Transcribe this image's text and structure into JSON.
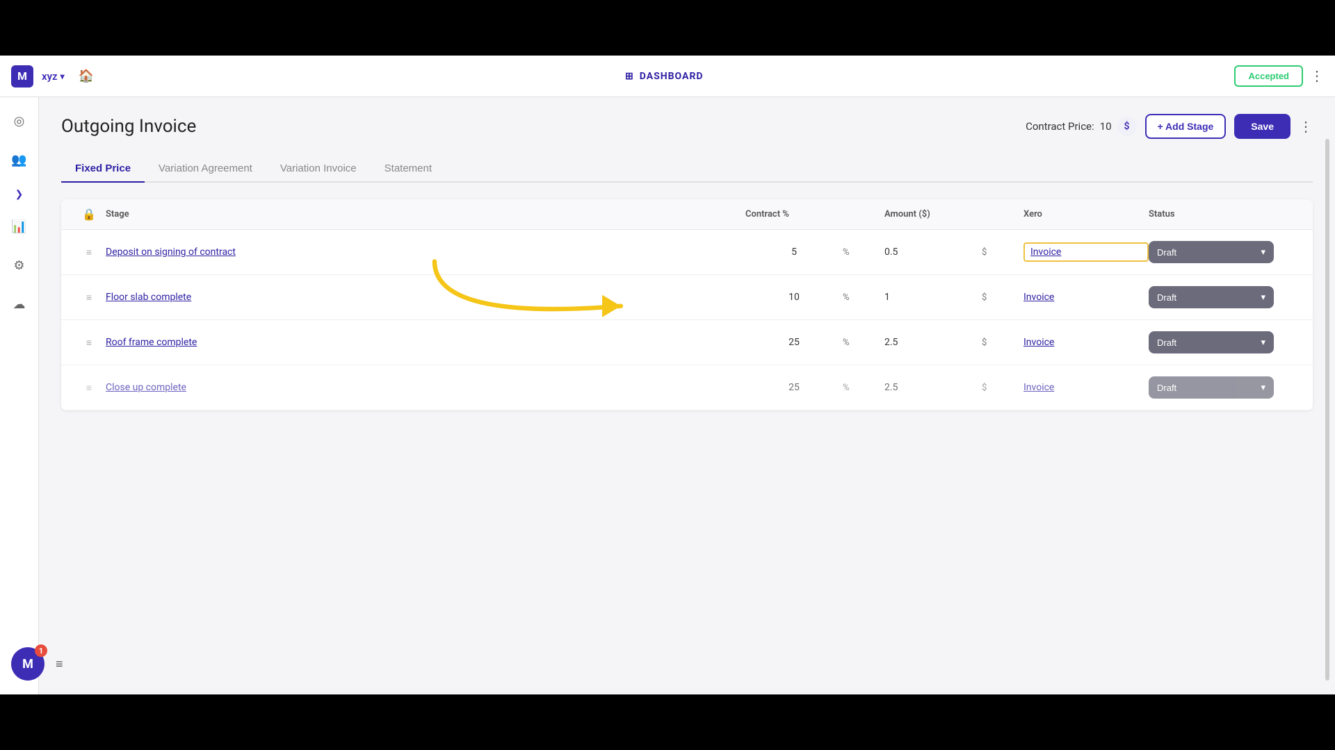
{
  "navbar": {
    "logo_letter": "M",
    "company": "xyz",
    "chevron": "▾",
    "home_icon": "🏠",
    "dashboard_label": "DASHBOARD",
    "dashboard_icon": "⊞",
    "accepted_label": "Accepted",
    "dots_label": "⋮"
  },
  "sidebar": {
    "expand_icon": "❯",
    "icons": [
      {
        "name": "chart-icon",
        "symbol": "◎"
      },
      {
        "name": "people-icon",
        "symbol": "👥"
      },
      {
        "name": "graph-icon",
        "symbol": "📊"
      },
      {
        "name": "settings-icon",
        "symbol": "⚙"
      },
      {
        "name": "cloud-icon",
        "symbol": "☁"
      }
    ]
  },
  "page": {
    "title": "Outgoing Invoice",
    "contract_price_label": "Contract Price:",
    "contract_price_value": "10",
    "currency_symbol": "$",
    "add_stage_label": "+ Add Stage",
    "save_label": "Save",
    "more_dots": "⋮"
  },
  "tabs": [
    {
      "id": "fixed-price",
      "label": "Fixed Price",
      "active": true
    },
    {
      "id": "variation-agreement",
      "label": "Variation Agreement",
      "active": false
    },
    {
      "id": "variation-invoice",
      "label": "Variation Invoice",
      "active": false
    },
    {
      "id": "statement",
      "label": "Statement",
      "active": false
    }
  ],
  "table": {
    "headers": {
      "lock": "🔒",
      "stage": "Stage",
      "contract_pct": "Contract %",
      "amount": "Amount ($)",
      "xero": "Xero",
      "status": "Status"
    },
    "rows": [
      {
        "drag": "≡",
        "stage_link": "Deposit on signing of contract",
        "contract_pct": "5",
        "pct_symbol": "%",
        "amount": "0.5",
        "dollar": "$",
        "xero_label": "Invoice",
        "xero_highlighted": true,
        "status": "Draft",
        "status_chevron": "▾"
      },
      {
        "drag": "≡",
        "stage_link": "Floor slab complete",
        "contract_pct": "10",
        "pct_symbol": "%",
        "amount": "1",
        "dollar": "$",
        "xero_label": "Invoice",
        "xero_highlighted": false,
        "status": "Draft",
        "status_chevron": "▾"
      },
      {
        "drag": "≡",
        "stage_link": "Roof frame complete",
        "contract_pct": "25",
        "pct_symbol": "%",
        "amount": "2.5",
        "dollar": "$",
        "xero_label": "Invoice",
        "xero_highlighted": false,
        "status": "Draft",
        "status_chevron": "▾"
      },
      {
        "drag": "≡",
        "stage_link": "Close up complete",
        "contract_pct": "25",
        "pct_symbol": "%",
        "amount": "2.5",
        "dollar": "$",
        "xero_label": "Invoice",
        "xero_highlighted": false,
        "status": "Draft",
        "status_chevron": "▾"
      }
    ]
  },
  "avatar": {
    "letter": "M",
    "notification_count": "1"
  },
  "colors": {
    "brand_purple": "#3d2db5",
    "status_gray": "#6b6b7b",
    "highlight_yellow": "#f0c040",
    "link_blue": "#2d1fa3"
  }
}
